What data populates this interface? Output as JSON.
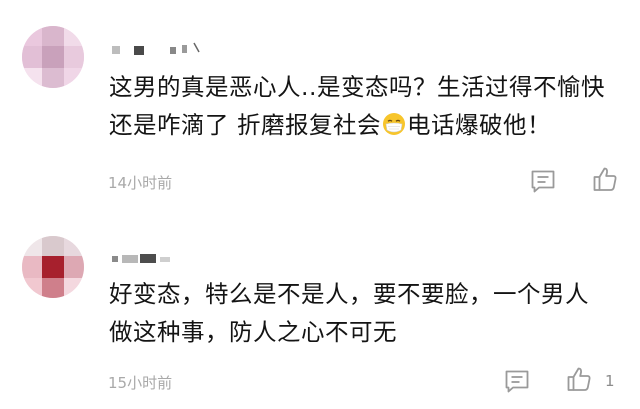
{
  "comments": [
    {
      "text_lines": [
        "这男的真是恶心人..是变态吗？生活过得不愉快",
        "还是咋滴了 折磨报复社会",
        "电话爆破他！"
      ],
      "emoji": "face-with-medical-mask",
      "time": "14小时前",
      "likes": ""
    },
    {
      "text_lines": [
        "好变态，特么是不是人，要不要脸，一个男人",
        "做这种事，防人之心不可无"
      ],
      "time": "15小时前",
      "likes": "1"
    }
  ],
  "icons": {
    "reply": "comment-icon",
    "like": "thumbs-up-icon"
  },
  "colors": {
    "text": "#141414",
    "meta": "#a9a9a9",
    "icon": "#9a9a9a"
  }
}
